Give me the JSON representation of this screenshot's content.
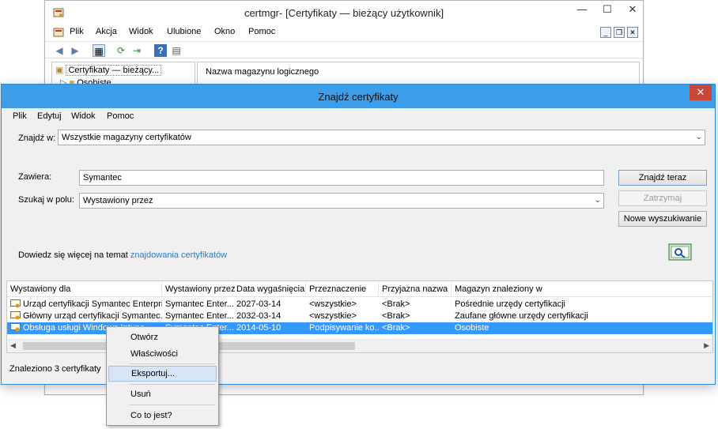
{
  "certmgr": {
    "title": "certmgr-  [Certyfikaty — bieżący użytkownik]",
    "menu": [
      "Plik",
      "Akcja",
      "Widok",
      "Ulubione",
      "Okno",
      "Pomoc"
    ],
    "tree": [
      "Certyfikaty — bieżący...",
      "Osobiste"
    ],
    "list_header": "Nazwa magazynu logicznego"
  },
  "dialog": {
    "title": "Znajdź certyfikaty",
    "close": "✕",
    "menu": [
      "Plik",
      "Edytuj",
      "Widok",
      "Pomoc"
    ],
    "search_in_label": "Znajdź w:",
    "search_in_value": "Wszystkie magazyny certyfikatów",
    "contains_label": "Zawiera:",
    "contains_value": "Symantec",
    "field_label": "Szukaj w polu:",
    "field_value": "Wystawiony przez",
    "find_now": "Znajdź teraz",
    "stop": "Zatrzymaj",
    "new_search": "Nowe wyszukiwanie",
    "learn_more_prefix": "Dowiedz się więcej na temat ",
    "learn_more_link": "znajdowania certyfikatów",
    "columns": [
      "Wystawiony dla",
      "Wystawiony przez",
      "Data wygaśnięcia",
      "Przeznaczenie",
      "Przyjazna nazwa",
      "Magazyn znaleziony w"
    ],
    "rows": [
      [
        "Urząd certyfikacji Symantec Enterpri...",
        "Symantec Enter...",
        "2027-03-14",
        "<wszystkie>",
        "<Brak>",
        "Pośrednie urzędy certyfikacji"
      ],
      [
        "Główny urząd certyfikacji Symantec...",
        "Symantec Enter...",
        "2032-03-14",
        "<wszystkie>",
        "<Brak>",
        "Zaufane główne urzędy certyfikacji"
      ],
      [
        "Obsługa usługi Windows Intune",
        "Symantec Enter...",
        "2014-05-10",
        "Podpisywanie ko...",
        "<Brak>",
        "Osobiste"
      ]
    ],
    "status": "Znaleziono 3 certyfikaty"
  },
  "context_menu": [
    "Otwórz",
    "Właściwości",
    "Eksportuj...",
    "Usuń",
    "Co to jest?"
  ],
  "colors": {
    "accent": "#3c9ee8",
    "selection": "#3399ff",
    "link": "#2a7cc7",
    "close": "#c7473b"
  }
}
